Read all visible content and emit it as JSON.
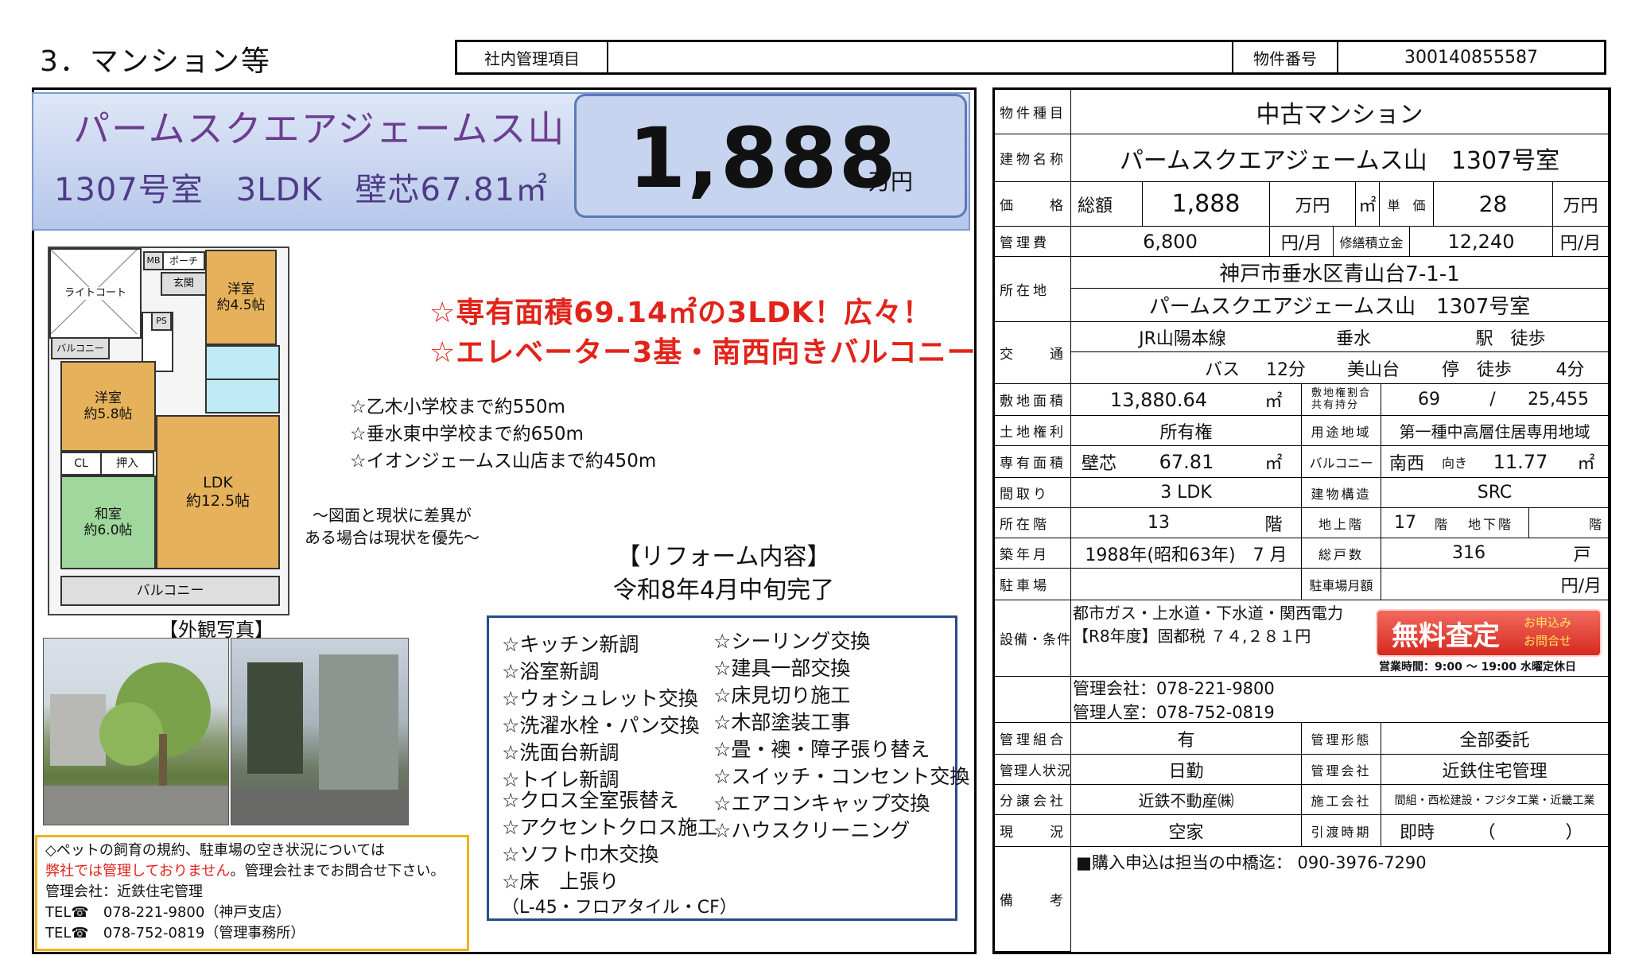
{
  "header": {
    "section_title": "3．マンション等",
    "admin_label": "社内管理項目",
    "admin_value": "",
    "property_number_label": "物件番号",
    "property_number": "300140855587"
  },
  "banner": {
    "name": "パームスクエアジェームス山",
    "room_info": "1307号室　3LDK　壁芯67.81㎡",
    "price": "1,888",
    "price_unit": "万円"
  },
  "floor_plan": {
    "light_court": "ライトコート",
    "mb": "MB",
    "porch": "ポーチ",
    "entrance": "玄関",
    "room_west_top": "洋室\n約4.5帖",
    "balcony_small": "バルコニー",
    "ps": "PS",
    "room_west": "洋室\n約5.8帖",
    "cl": "CL",
    "oshiire": "押入",
    "ldk": "LDK\n約12.5帖",
    "washitsu": "和室\n約6.0帖",
    "balcony": "バルコニー"
  },
  "headlines": {
    "line1": "☆専有面積69.14㎡の3LDK！広々！",
    "line2": "☆エレベーター3基・南西向きバルコニー"
  },
  "nearby": [
    "☆乙木小学校まで約550m",
    "☆垂水東中学校まで約650m",
    "☆イオンジェームス山店まで約450m"
  ],
  "plan_note": "～図面と現状に差異が\nある場合は現状を優先～",
  "reform": {
    "title": "【リフォーム内容】",
    "subtitle": "令和8年4月中旬完了",
    "left": [
      "☆キッチン新調",
      "☆浴室新調",
      "☆ウォシュレット交換",
      "☆洗濯水栓・パン交換",
      "☆洗面台新調",
      "☆トイレ新調",
      "☆クロス全室張替え",
      "☆アクセントクロス施工",
      "☆ソフト巾木交換",
      "☆床　上張り",
      "（L-45・フロアタイル・CF）"
    ],
    "right": [
      "☆シーリング交換",
      "☆建具一部交換",
      "☆床見切り施工",
      "☆木部塗装工事",
      "☆畳・襖・障子張り替え",
      "☆スイッチ・コンセント交換",
      "☆エアコンキャップ交換",
      "☆ハウスクリーニング"
    ]
  },
  "photos_title": "【外観写真】",
  "pet_notice": {
    "line1": "◇ペットの飼育の規約、駐車場の空き状況については",
    "line2_red": "弊社では管理しておりません",
    "line2_rest": "。管理会社までお問合せ下さい。",
    "line3": "管理会社：近鉄住宅管理",
    "line4": "TEL☎　078-221-9800（神戸支店）",
    "line5": "TEL☎　078-752-0819（管理事務所）"
  },
  "table": {
    "type_label": "物件種目",
    "type": "中古マンション",
    "building_label": "建物名称",
    "building": "パームスクエアジェームス山　1307号室",
    "price_label": "価　　格",
    "total_label": "総額",
    "total": "1,888",
    "man_yen": "万円",
    "sqm_mark": "㎡",
    "unit_price_label": "単　価",
    "unit_price": "28",
    "mgmt_fee_label": "管理費",
    "mgmt_fee": "6,800",
    "yen_month": "円/月",
    "repair_label": "修繕積立金",
    "repair": "12,240",
    "address_label": "所在地",
    "address1": "神戸市垂水区青山台7-1-1",
    "address2": "パームスクエアジェームス山　1307号室",
    "transport_label": "交　　通",
    "line": "JR山陽本線",
    "station": "垂水",
    "station_suffix": "駅　徒歩",
    "bus": "バス",
    "bus_min": "12分",
    "bus_stop": "美山台",
    "stop_suffix": "停　徒歩",
    "walk_min": "4分",
    "land_area_label": "敷地面積",
    "land_area": "13,880.64",
    "sqm": "㎡",
    "share_label": "敷地権割合\n共有持分",
    "share_num": "69",
    "slash": "/",
    "share_den": "25,455",
    "land_right_label": "土地権利",
    "land_right": "所有権",
    "zoning_label": "用途地域",
    "zoning": "第一種中高層住居専用地域",
    "exclusive_label": "専有面積",
    "wall_core": "壁芯",
    "exclusive_area": "67.81",
    "balcony_label": "バルコニー",
    "balcony_dir": "南西",
    "facing": "向き",
    "balcony_area": "11.77",
    "layout_label": "間取り",
    "layout": "3 LDK",
    "structure_label": "建物構造",
    "structure": "SRC",
    "floor_label": "所在階",
    "floor": "13",
    "kai": "階",
    "above_label": "地上階",
    "above": "17",
    "below_label": "地下階",
    "built_label": "築年月",
    "built": "1988年(昭和63年)　7 月",
    "units_label": "総戸数",
    "units": "316",
    "ko": "戸",
    "parking_label": "駐車場",
    "parking_fee_label": "駐車場月額",
    "facilities_label": "設備・条件",
    "facilities1": "都市ガス・上水道・下水道・関西電力",
    "facilities2": "【R8年度】固都税 ７４,２８１円",
    "mgmt_company_tel": "管理会社：078-221-9800",
    "mgmt_office_tel": "管理人室：078-752-0819",
    "assoc_label": "管理組合",
    "assoc": "有",
    "mgmt_form_label": "管理形態",
    "mgmt_form": "全部委託",
    "manager_label": "管理人状況",
    "manager": "日勤",
    "mgmt_co_label": "管理会社",
    "mgmt_co": "近鉄住宅管理",
    "seller_label": "分譲会社",
    "seller": "近鉄不動産㈱",
    "builder_label": "施工会社",
    "builder": "間組・西松建設・フジタ工業・近畿工業",
    "status_label": "現　　況",
    "status": "空家",
    "handover_label": "引渡時期",
    "handover": "即時",
    "handover_paren": "（　　　　）",
    "remarks_label": "備　　考",
    "remarks": "■購入申込は担当の中橋迄： 090-3976-7290"
  },
  "free_assess": {
    "main": "無料査定",
    "sub1": "お申込み",
    "sub2": "お問合せ",
    "hours": "営業時間：9:00 ～ 19:00  水曜定休日"
  }
}
